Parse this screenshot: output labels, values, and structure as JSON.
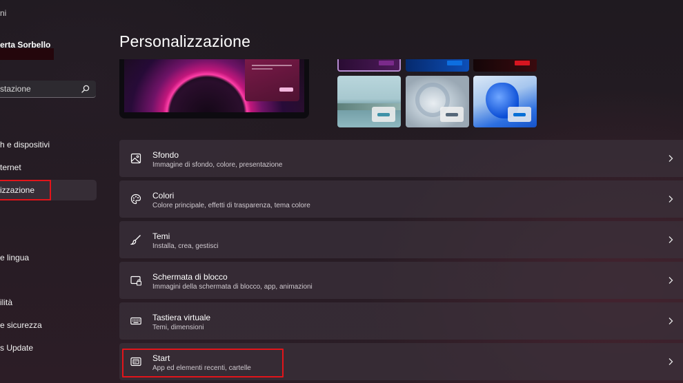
{
  "window": {
    "title_fragment": "ni"
  },
  "user": {
    "name_fragment": "erta Sorbello"
  },
  "search": {
    "placeholder": "stazione"
  },
  "sidebar": {
    "items": [
      {
        "label": "h e dispositivi"
      },
      {
        "label": "ternet"
      },
      {
        "label": "izzazione",
        "active": true
      },
      {
        "label": "e lingua"
      },
      {
        "label": "ilità"
      },
      {
        "label": "e sicurezza"
      },
      {
        "label": "s Update"
      }
    ]
  },
  "page": {
    "title": "Personalizzazione"
  },
  "settings": [
    {
      "title": "Sfondo",
      "subtitle": "Immagine di sfondo, colore, presentazione",
      "icon": "image-icon"
    },
    {
      "title": "Colori",
      "subtitle": "Colore principale, effetti di trasparenza, tema colore",
      "icon": "palette-icon"
    },
    {
      "title": "Temi",
      "subtitle": "Installa, crea, gestisci",
      "icon": "brush-icon"
    },
    {
      "title": "Schermata di blocco",
      "subtitle": "Immagini della schermata di blocco, app, animazioni",
      "icon": "lock-screen-icon"
    },
    {
      "title": "Tastiera virtuale",
      "subtitle": "Temi, dimensioni",
      "icon": "keyboard-icon"
    },
    {
      "title": "Start",
      "subtitle": "App ed elementi recenti, cartelle",
      "icon": "start-icon"
    }
  ],
  "colors": {
    "highlight": "#e3141a",
    "accent_blue": "#0a6fd6"
  }
}
